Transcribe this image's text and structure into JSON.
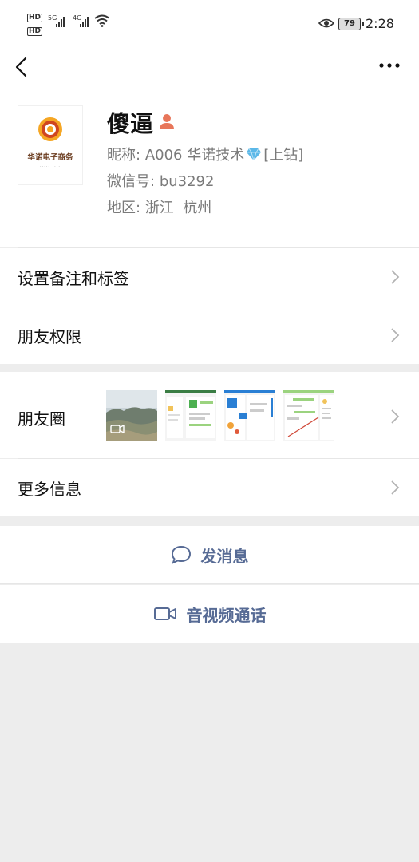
{
  "status_bar": {
    "hd1": "HD",
    "hd2": "HD",
    "net1": "5G",
    "net2": "4G",
    "battery": "79",
    "time": "2:28"
  },
  "nav": {
    "back_icon": "chevron-left-icon",
    "more_icon": "more-dots-icon"
  },
  "profile": {
    "avatar_brand": "华诺电子商务",
    "name": "傻逼",
    "nickname_label": "昵称:",
    "nickname_value_before": "A006 华诺技术",
    "nickname_value_after": "[上钻]",
    "wechat_id_label": "微信号:",
    "wechat_id_value": "bu3292",
    "region_label": "地区:",
    "region_value": "浙江  杭州"
  },
  "rows": {
    "remark": "设置备注和标签",
    "permission": "朋友权限",
    "moments": "朋友圈",
    "more_info": "更多信息"
  },
  "actions": {
    "send_message": "发消息",
    "av_call": "音视频通话"
  },
  "colors": {
    "link_blue": "#576b95",
    "background_gray": "#ededed",
    "person_icon": "#e8765a",
    "diamond": "#5bb8e8"
  }
}
